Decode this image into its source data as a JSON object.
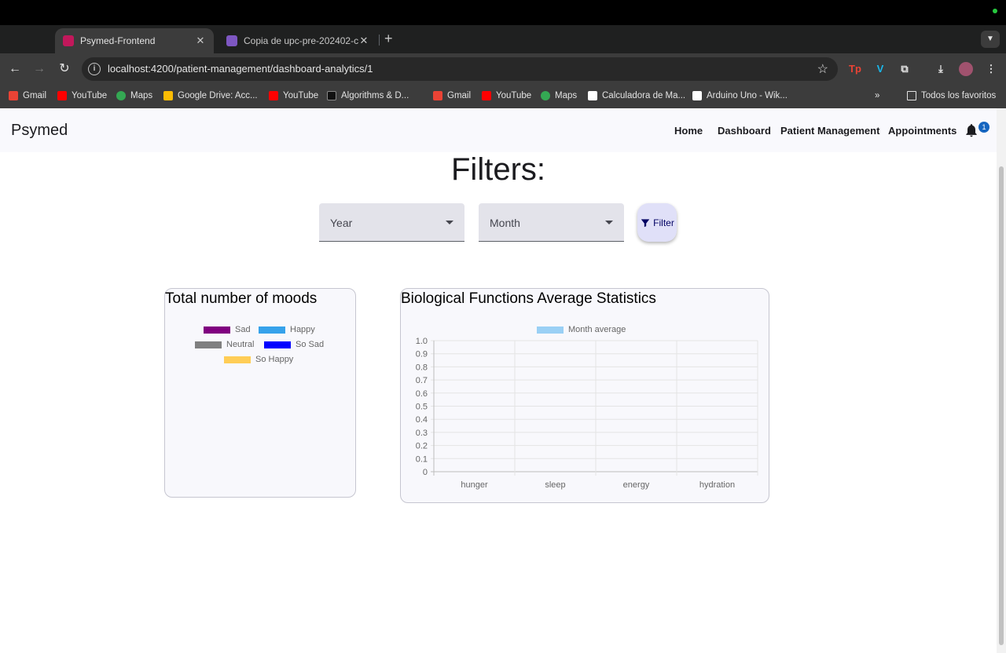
{
  "browser": {
    "tabs": [
      {
        "title": "Psymed-Frontend",
        "active": true
      },
      {
        "title": "Copia de upc-pre-202402-cc",
        "active": false
      }
    ],
    "url": "localhost:4200/patient-management/dashboard-analytics/1",
    "bookmarks": [
      "Gmail",
      "YouTube",
      "Maps",
      "Google Drive: Acc...",
      "YouTube",
      "Algorithms & D...",
      "Gmail",
      "YouTube",
      "Maps",
      "Calculadora de Ma...",
      "Arduino Uno - Wik..."
    ],
    "all_bookmarks": "Todos los favoritos"
  },
  "app": {
    "brand": "Psymed",
    "nav": [
      "Home",
      "Dashboard",
      "Patient Management",
      "Appointments"
    ],
    "notification_count": "1"
  },
  "filters": {
    "title": "Filters:",
    "year_label": "Year",
    "month_label": "Month",
    "button_label": "Filter"
  },
  "moods_card": {
    "title": "Total number of moods",
    "legend": [
      {
        "label": "Sad",
        "color": "#800080"
      },
      {
        "label": "Happy",
        "color": "#36a2eb"
      },
      {
        "label": "Neutral",
        "color": "#808080"
      },
      {
        "label": "So Sad",
        "color": "#0000ff"
      },
      {
        "label": "So Happy",
        "color": "#ffcd56"
      }
    ]
  },
  "bio_card": {
    "title": "Biological Functions Average Statistics"
  },
  "chart_data": {
    "type": "bar",
    "categories": [
      "hunger",
      "sleep",
      "energy",
      "hydration"
    ],
    "series": [
      {
        "name": "Month average",
        "values": [
          0,
          0,
          0,
          0
        ],
        "color": "#9ad0f5"
      }
    ],
    "ylim": [
      0,
      1.0
    ],
    "yticks": [
      "0",
      "0.1",
      "0.2",
      "0.3",
      "0.4",
      "0.5",
      "0.6",
      "0.7",
      "0.8",
      "0.9",
      "1.0"
    ],
    "grid": true,
    "legend": "top"
  }
}
